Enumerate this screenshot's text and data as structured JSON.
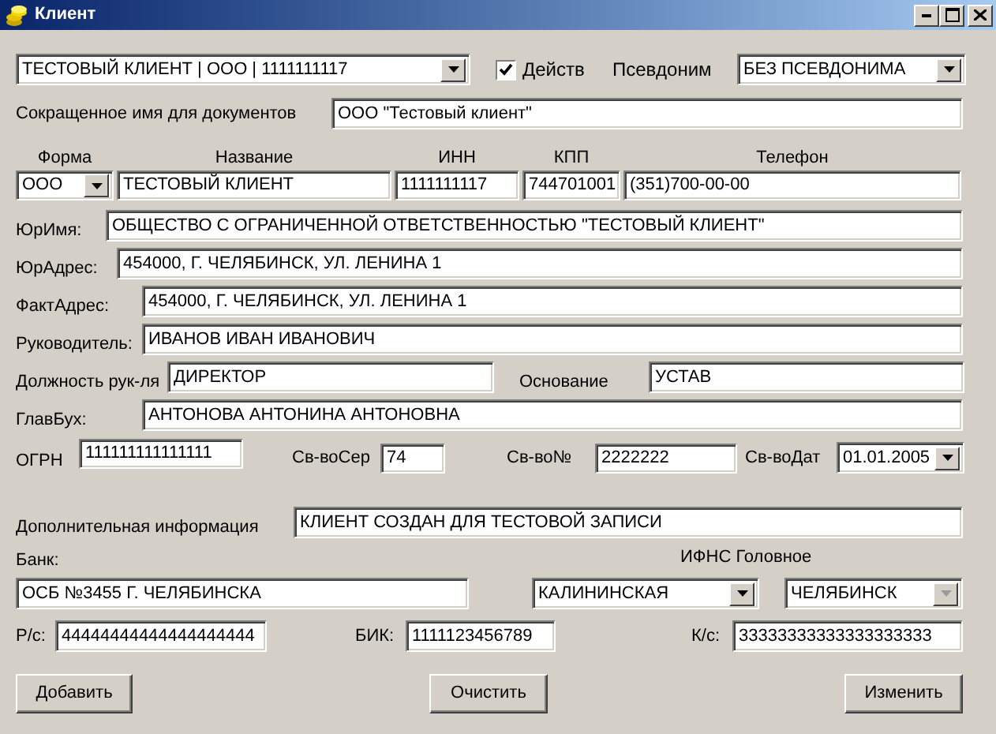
{
  "window": {
    "title": "Клиент"
  },
  "client": {
    "value": "ТЕСТОВЫЙ КЛИЕНТ | ООО | 1111111117",
    "disabled": false
  },
  "active": {
    "label": "Действ",
    "checked": true
  },
  "alias": {
    "label": "Псевдоним",
    "value": "БЕЗ ПСЕВДОНИМА",
    "disabled": false
  },
  "short_name": {
    "label": "Сокращенное имя для документов",
    "value": "ООО \"Тестовый клиент\""
  },
  "columns": [
    "Форма",
    "Название",
    "ИНН",
    "КПП",
    "Телефон"
  ],
  "form": {
    "value": "ООО",
    "disabled": false
  },
  "name": {
    "value": "ТЕСТОВЫЙ КЛИЕНТ"
  },
  "inn": {
    "value": "1111111117"
  },
  "kpp": {
    "value": "744701001"
  },
  "phone": {
    "value": "(351)700-00-00"
  },
  "legal_name": {
    "label": "ЮрИмя:",
    "value": "ОБЩЕСТВО С ОГРАНИЧЕННОЙ ОТВЕТСТВЕННОСТЬЮ \"ТЕСТОВЫЙ КЛИЕНТ\""
  },
  "legal_address": {
    "label": "ЮрАдрес:",
    "value": "454000, Г. ЧЕЛЯБИНСК, УЛ. ЛЕНИНА 1"
  },
  "actual_address": {
    "label": "ФактАдрес:",
    "value": "454000, Г. ЧЕЛЯБИНСК, УЛ. ЛЕНИНА 1"
  },
  "director": {
    "label": "Руководитель:",
    "value": "ИВАНОВ ИВАН ИВАНОВИЧ"
  },
  "director_position": {
    "label": "Должность рук-ля",
    "value": "ДИРЕКТОР"
  },
  "basis": {
    "label": "Основание",
    "value": "УСТАВ"
  },
  "chief_accountant": {
    "label": "ГлавБух:",
    "value": "АНТОНОВА АНТОНИНА АНТОНОВНА"
  },
  "ogrn": {
    "label": "ОГРН",
    "value": "111111111111111"
  },
  "cert_series": {
    "label": "Св-воСер",
    "value": "74"
  },
  "cert_number": {
    "label": "Св-во№",
    "value": "2222222"
  },
  "cert_date": {
    "label": "Св-воДат",
    "value": "01.01.2005",
    "disabled": false
  },
  "additional_info": {
    "label": "Дополнительная информация",
    "value": "КЛИЕНТ СОЗДАН ДЛЯ ТЕСТОВОЙ ЗАПИСИ"
  },
  "bank": {
    "label": "Банк:",
    "value": "ОСБ №3455 Г. ЧЕЛЯБИНСКА"
  },
  "ifns": {
    "label": "ИФНС Головное",
    "value": "КАЛИНИНСКАЯ",
    "disabled": false
  },
  "ifns_main": {
    "value": "ЧЕЛЯБИНСК",
    "disabled": true
  },
  "account": {
    "label": "Р/с:",
    "value": "44444444444444444444"
  },
  "bik": {
    "label": "БИК:",
    "value": "1111123456789"
  },
  "corr_account": {
    "label": "К/с:",
    "value": "33333333333333333333"
  },
  "buttons": [
    "Добавить",
    "Очистить",
    "Изменить"
  ]
}
